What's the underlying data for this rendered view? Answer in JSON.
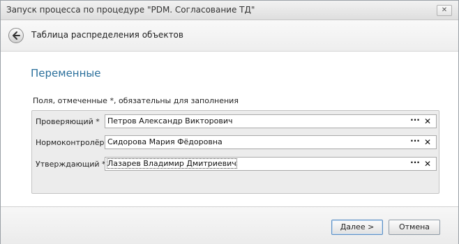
{
  "window": {
    "title": "Запуск процесса по процедуре \"PDM. Согласование ТД\"",
    "close_label": "✕"
  },
  "nav": {
    "title": "Таблица распределения объектов"
  },
  "section": {
    "title": "Переменные",
    "hint": "Поля, отмеченные *, обязательны для заполнения"
  },
  "fields": [
    {
      "label": "Проверяющий *",
      "value": "Петров Александр Викторович",
      "browse": "···",
      "clear": "✕"
    },
    {
      "label": "Нормоконтролёр *",
      "value": "Сидорова Мария Фёдоровна",
      "browse": "···",
      "clear": "✕"
    },
    {
      "label": "Утверждающий *",
      "value": "Лазарев Владимир Дмитриевич",
      "browse": "···",
      "clear": "✕"
    }
  ],
  "footer": {
    "next_label": "Далее >",
    "cancel_label": "Отмена"
  }
}
